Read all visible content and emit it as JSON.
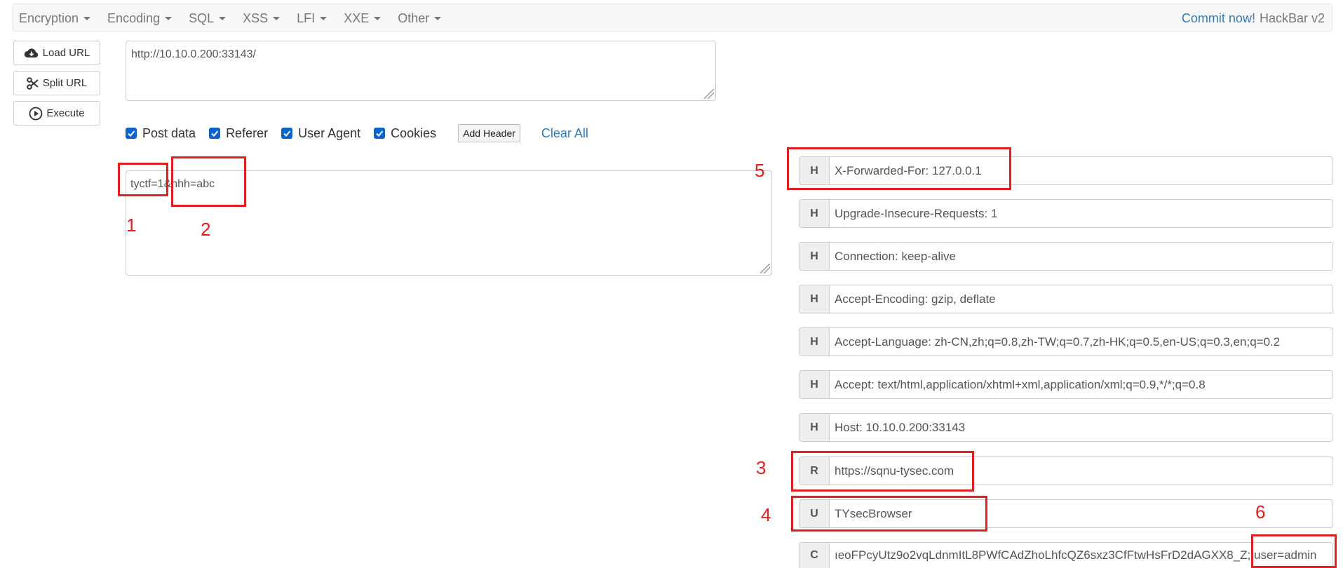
{
  "nav": {
    "menus": [
      "Encryption",
      "Encoding",
      "SQL",
      "XSS",
      "LFI",
      "XXE",
      "Other"
    ],
    "commit": "Commit now!",
    "brand": "HackBar v2"
  },
  "side_buttons": {
    "load": "Load URL",
    "split": "Split URL",
    "execute": "Execute"
  },
  "url": "http://10.10.0.200:33143/",
  "options": {
    "post_data": "Post data",
    "referer": "Referer",
    "user_agent": "User Agent",
    "cookies": "Cookies",
    "add_header": "Add Header",
    "clear_all": "Clear All"
  },
  "post_body": "tyctf=1&hhh=abc",
  "headers": [
    {
      "tag": "H",
      "value": "X-Forwarded-For: 127.0.0.1"
    },
    {
      "tag": "H",
      "value": "Upgrade-Insecure-Requests: 1"
    },
    {
      "tag": "H",
      "value": "Connection: keep-alive"
    },
    {
      "tag": "H",
      "value": "Accept-Encoding: gzip, deflate"
    },
    {
      "tag": "H",
      "value": "Accept-Language: zh-CN,zh;q=0.8,zh-TW;q=0.7,zh-HK;q=0.5,en-US;q=0.3,en;q=0.2"
    },
    {
      "tag": "H",
      "value": "Accept: text/html,application/xhtml+xml,application/xml;q=0.9,*/*;q=0.8"
    },
    {
      "tag": "H",
      "value": "Host: 10.10.0.200:33143"
    },
    {
      "tag": "R",
      "value": "https://sqnu-tysec.com"
    },
    {
      "tag": "U",
      "value": "TYsecBrowser"
    },
    {
      "tag": "C",
      "value": "ıeoFPcyUtz9o2vqLdnmItL8PWfCAdZhoLhfcQZ6sxz3CfFtwHsFrD2dAGXX8_Z; user=admin"
    }
  ],
  "annotations": [
    "1",
    "2",
    "3",
    "4",
    "5",
    "6"
  ],
  "colors": {
    "accent": "#337ab7",
    "annotation": "#e02020",
    "checkbox": "#0b63ce"
  }
}
